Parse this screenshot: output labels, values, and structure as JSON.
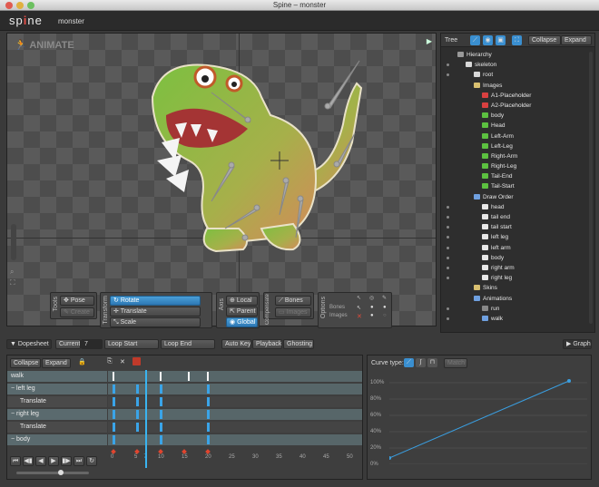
{
  "window": {
    "title": "Spine – monster"
  },
  "app": {
    "logo_left": "sp",
    "logo_mid": "i",
    "logo_right": "ne",
    "project": "monster"
  },
  "viewport": {
    "mode_label": "ANIMATE"
  },
  "tools": {
    "tools_label": "Tools",
    "pose": "Pose",
    "create": "Create",
    "transform_label": "Transform",
    "rotate": "Rotate",
    "translate": "Translate",
    "scale": "Scale",
    "axis_label": "Axis",
    "local": "Local",
    "parent": "Parent",
    "global": "Global",
    "compensate_label": "Compensate",
    "bones": "Bones",
    "images": "Images",
    "options_label": "Options",
    "opt_bones": "Bones",
    "opt_images": "Images"
  },
  "tree": {
    "label": "Tree",
    "collapse": "Collapse",
    "expand": "Expand",
    "items": [
      {
        "label": "Hierarchy",
        "indent": 0,
        "icon": "hierarchy-icon",
        "color": "#999999"
      },
      {
        "label": "skeleton",
        "indent": 1,
        "icon": "skeleton-icon",
        "color": "#d8d8d8"
      },
      {
        "label": "root",
        "indent": 2,
        "icon": "bone-icon",
        "color": "#d8d8d8"
      },
      {
        "label": "Images",
        "indent": 2,
        "icon": "folder-icon",
        "color": "#d9c070"
      },
      {
        "label": "A1-Placeholder",
        "indent": 3,
        "icon": "image-icon",
        "color": "#d94040"
      },
      {
        "label": "A2-Placeholder",
        "indent": 3,
        "icon": "image-icon",
        "color": "#d94040"
      },
      {
        "label": "body",
        "indent": 3,
        "icon": "image-icon",
        "color": "#5cc040"
      },
      {
        "label": "Head",
        "indent": 3,
        "icon": "image-icon",
        "color": "#5cc040"
      },
      {
        "label": "Left-Arm",
        "indent": 3,
        "icon": "image-icon",
        "color": "#5cc040"
      },
      {
        "label": "Left-Leg",
        "indent": 3,
        "icon": "image-icon",
        "color": "#5cc040"
      },
      {
        "label": "Right-Arm",
        "indent": 3,
        "icon": "image-icon",
        "color": "#5cc040"
      },
      {
        "label": "Right-Leg",
        "indent": 3,
        "icon": "image-icon",
        "color": "#5cc040"
      },
      {
        "label": "Tail-End",
        "indent": 3,
        "icon": "image-icon",
        "color": "#5cc040"
      },
      {
        "label": "Tail-Start",
        "indent": 3,
        "icon": "image-icon",
        "color": "#5cc040"
      },
      {
        "label": "Draw Order",
        "indent": 2,
        "icon": "draw-order-icon",
        "color": "#6fa0e0"
      },
      {
        "label": "head",
        "indent": 3,
        "icon": "slot-icon",
        "color": "#e8e8e8"
      },
      {
        "label": "tail end",
        "indent": 3,
        "icon": "slot-icon",
        "color": "#e8e8e8"
      },
      {
        "label": "tail start",
        "indent": 3,
        "icon": "slot-icon",
        "color": "#e8e8e8"
      },
      {
        "label": "left leg",
        "indent": 3,
        "icon": "slot-icon",
        "color": "#e8e8e8"
      },
      {
        "label": "left arm",
        "indent": 3,
        "icon": "slot-icon",
        "color": "#e8e8e8"
      },
      {
        "label": "body",
        "indent": 3,
        "icon": "slot-icon",
        "color": "#e8e8e8"
      },
      {
        "label": "right arm",
        "indent": 3,
        "icon": "slot-icon",
        "color": "#e8e8e8"
      },
      {
        "label": "right leg",
        "indent": 3,
        "icon": "slot-icon",
        "color": "#e8e8e8"
      },
      {
        "label": "Skins",
        "indent": 2,
        "icon": "skins-icon",
        "color": "#d9c070"
      },
      {
        "label": "Animations",
        "indent": 2,
        "icon": "animations-icon",
        "color": "#6fa0e0"
      },
      {
        "label": "run",
        "indent": 3,
        "icon": "animation-icon",
        "color": "#888888"
      },
      {
        "label": "walk",
        "indent": 3,
        "icon": "animation-icon",
        "color": "#6fa0e0"
      }
    ]
  },
  "dopebar": {
    "dopesheet": "Dopesheet",
    "current_label": "Current",
    "current_value": "7",
    "loop_start": "Loop Start",
    "loop_end": "Loop End",
    "auto_key": "Auto Key",
    "playback": "Playback",
    "ghosting": "Ghosting",
    "graph": "Graph"
  },
  "dopesheet": {
    "collapse": "Collapse",
    "expand": "Expand",
    "rows": [
      {
        "label": "walk"
      },
      {
        "label": "left leg"
      },
      {
        "label": "Translate"
      },
      {
        "label": "right leg"
      },
      {
        "label": "Translate"
      },
      {
        "label": "body"
      }
    ],
    "ticks": [
      "0",
      "5",
      "7",
      "10",
      "15",
      "20",
      "25",
      "30",
      "35",
      "40",
      "45",
      "50"
    ]
  },
  "graph": {
    "curve_type": "Curve type:",
    "match": "Match",
    "y_labels": [
      "100%",
      "80%",
      "60%",
      "40%",
      "20%",
      "0%"
    ]
  },
  "colors": {
    "accent": "#3a9ee0",
    "key_red": "#e0452f"
  }
}
